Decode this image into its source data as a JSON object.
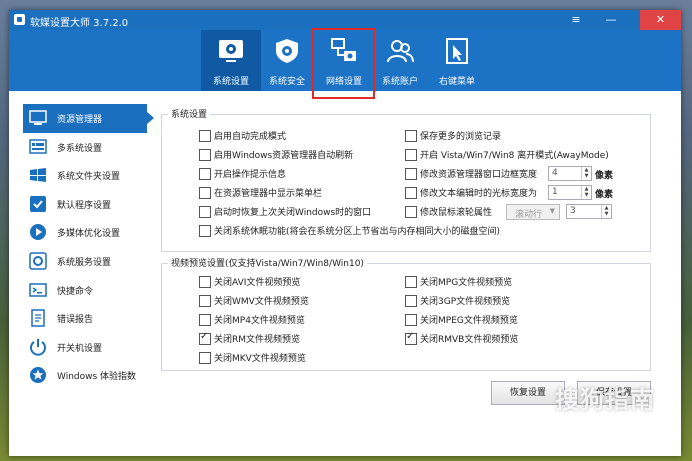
{
  "app": {
    "title": "软媒设置大师 3.7.2.0",
    "logo_icon": "app-logo-icon"
  },
  "window_controls": {
    "menu": "≡",
    "minimize": "—",
    "close": "✕"
  },
  "toolbar": {
    "accent": "#1c72c4",
    "items": [
      {
        "label": "系统设置",
        "icon": "gear-monitor-icon",
        "active": true
      },
      {
        "label": "系统安全",
        "icon": "shield-gear-icon",
        "active": false
      },
      {
        "label": "网络设置",
        "icon": "network-icon",
        "active": false
      },
      {
        "label": "系统账户",
        "icon": "users-icon",
        "active": false
      },
      {
        "label": "右键菜单",
        "icon": "cursor-menu-icon",
        "active": false
      }
    ]
  },
  "sidebar": {
    "items": [
      {
        "label": "资源管理器",
        "icon": "explorer-icon",
        "active": true
      },
      {
        "label": "多系统设置",
        "icon": "multi-system-icon"
      },
      {
        "label": "系统文件夹设置",
        "icon": "windows-folder-icon"
      },
      {
        "label": "默认程序设置",
        "icon": "default-program-icon"
      },
      {
        "label": "多媒体优化设置",
        "icon": "multimedia-icon"
      },
      {
        "label": "系统服务设置",
        "icon": "service-icon"
      },
      {
        "label": "快捷命令",
        "icon": "shortcut-icon"
      },
      {
        "label": "错误报告",
        "icon": "error-report-icon"
      },
      {
        "label": "开关机设置",
        "icon": "power-icon"
      },
      {
        "label": "Windows 体验指数",
        "icon": "star-icon"
      }
    ]
  },
  "system_settings": {
    "title": "系统设置",
    "left": [
      {
        "label": "启用自动完成模式",
        "checked": false
      },
      {
        "label": "启用Windows资源管理器自动刷新",
        "checked": false
      },
      {
        "label": "开启操作提示信息",
        "checked": false
      },
      {
        "label": "在资源管理器中显示菜单栏",
        "checked": false
      },
      {
        "label": "启动时恢复上次关闭Windows时的窗口",
        "checked": false
      }
    ],
    "right": [
      {
        "label": "保存更多的浏览记录",
        "checked": false
      },
      {
        "label": "开启 Vista/Win7/Win8 离开模式(AwayMode)",
        "checked": false
      },
      {
        "label": "修改资源管理器窗口边框宽度",
        "checked": false
      },
      {
        "label": "修改文本编辑时的光标宽度为",
        "checked": false
      },
      {
        "label": "修改鼠标滚轮属性",
        "checked": false
      }
    ],
    "border_width": {
      "value": "4",
      "unit": "像素"
    },
    "cursor_width": {
      "value": "1",
      "unit": "像素"
    },
    "wheel_mode": {
      "value": "滚动行"
    },
    "wheel_lines": {
      "value": "3"
    },
    "full_row": {
      "label": "关闭系统休眠功能(将会在系统分区上节省出与内存相同大小的磁盘空间)",
      "checked": false
    }
  },
  "video_preview": {
    "title": "视频预览设置(仅支持Vista/Win7/Win8/Win10)",
    "left": [
      {
        "label": "关闭AVI文件视频预览",
        "checked": false
      },
      {
        "label": "关闭WMV文件视频预览",
        "checked": false
      },
      {
        "label": "关闭MP4文件视频预览",
        "checked": false
      },
      {
        "label": "关闭RM文件视频预览",
        "checked": true
      },
      {
        "label": "关闭MKV文件视频预览",
        "checked": false
      }
    ],
    "right": [
      {
        "label": "关闭MPG文件视频预览",
        "checked": false
      },
      {
        "label": "关闭3GP文件视频预览",
        "checked": false
      },
      {
        "label": "关闭MPEG文件视频预览",
        "checked": false
      },
      {
        "label": "关闭RMVB文件视频预览",
        "checked": true
      }
    ]
  },
  "buttons": {
    "restore": "恢复设置",
    "save": "保存设置"
  },
  "watermark": {
    "main": "搜狗指南",
    "sub": "zhinan.sogou.com"
  }
}
